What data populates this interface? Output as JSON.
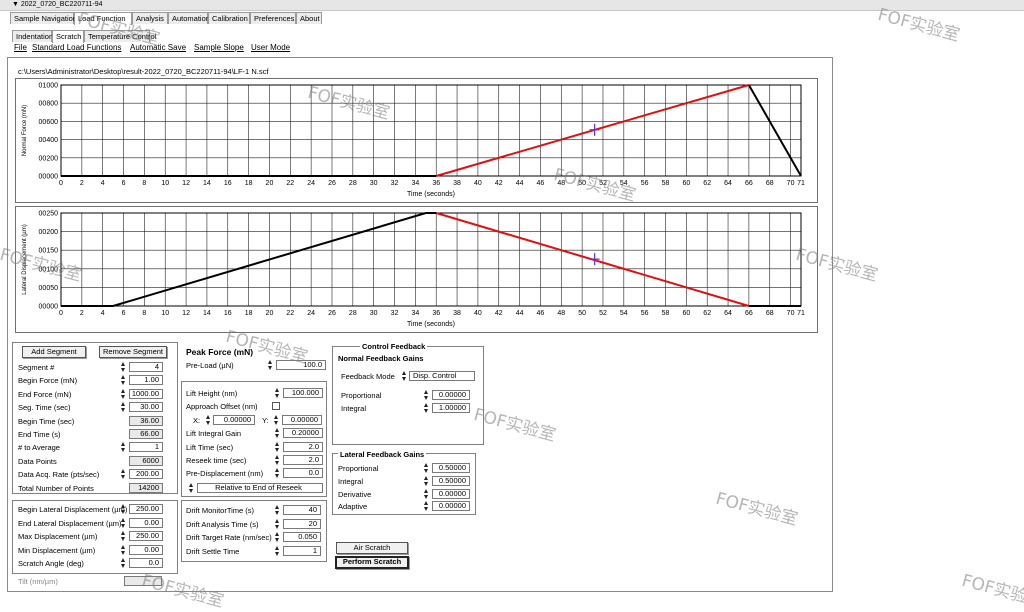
{
  "window": {
    "title": "▼ 2022_0720_BC220711-94"
  },
  "main_tabs": [
    "Sample Navigation",
    "Load Function",
    "Analysis",
    "Automation",
    "Calibration",
    "Preferences",
    "About"
  ],
  "sub_tabs": [
    "Indentation",
    "Scratch",
    "Temperature Control"
  ],
  "menu": [
    "File",
    "Standard Load Functions",
    "Automatic Save",
    "Sample Slope",
    "User Mode"
  ],
  "file_path": "c:\\Users\\Administrator\\Desktop\\result-2022_0720_BC220711-94\\LF-1 N.scf",
  "chart_data": [
    {
      "type": "line",
      "ylabel": "Normal Force (mN)",
      "xlabel": "Time (seconds)",
      "ylim": [
        0,
        1000
      ],
      "xlim": [
        0,
        71
      ],
      "yticks": [
        "00000",
        "00200",
        "00400",
        "00600",
        "00800",
        "01000"
      ],
      "xticks": [
        "0",
        "2",
        "4",
        "6",
        "8",
        "10",
        "12",
        "14",
        "16",
        "18",
        "20",
        "22",
        "24",
        "26",
        "28",
        "30",
        "32",
        "34",
        "36",
        "38",
        "40",
        "42",
        "44",
        "46",
        "48",
        "50",
        "52",
        "54",
        "56",
        "58",
        "60",
        "62",
        "64",
        "66",
        "68",
        "70",
        "71"
      ],
      "grid": true,
      "series": [
        {
          "color": "#000000",
          "x": [
            0,
            36
          ],
          "y": [
            0,
            0
          ]
        },
        {
          "color": "#e01010",
          "x": [
            36,
            66
          ],
          "y": [
            0,
            1000
          ]
        },
        {
          "color": "#000000",
          "x": [
            66,
            71
          ],
          "y": [
            1000,
            0
          ]
        }
      ],
      "marker": {
        "x": 51.2,
        "y": 508
      }
    },
    {
      "type": "line",
      "ylabel": "Lateral Displacement (µm)",
      "xlabel": "Time (seconds)",
      "ylim": [
        0,
        250
      ],
      "xlim": [
        0,
        71
      ],
      "yticks": [
        "00000",
        "00050",
        "00100",
        "00150",
        "00200",
        "00250"
      ],
      "xticks": [
        "0",
        "2",
        "4",
        "6",
        "8",
        "10",
        "12",
        "14",
        "16",
        "18",
        "20",
        "22",
        "24",
        "26",
        "28",
        "30",
        "32",
        "34",
        "36",
        "38",
        "40",
        "42",
        "44",
        "46",
        "48",
        "50",
        "52",
        "54",
        "56",
        "58",
        "60",
        "62",
        "64",
        "66",
        "68",
        "70",
        "71"
      ],
      "grid": true,
      "series": [
        {
          "color": "#000000",
          "x": [
            0,
            5,
            35,
            36
          ],
          "y": [
            0,
            0,
            250,
            250
          ]
        },
        {
          "color": "#e01010",
          "x": [
            36,
            66
          ],
          "y": [
            250,
            0
          ]
        },
        {
          "color": "#000000",
          "x": [
            66,
            71
          ],
          "y": [
            0,
            0
          ]
        }
      ],
      "marker": {
        "x": 51.2,
        "y": 126
      }
    }
  ],
  "segments": {
    "add_label": "Add Segment",
    "remove_label": "Remove Segment",
    "rows": [
      {
        "label": "Segment #",
        "value": "4"
      },
      {
        "label": "Begin Force (mN)",
        "value": "1.00"
      },
      {
        "label": "End Force (mN)",
        "value": "1000.00"
      },
      {
        "label": "Seg. Time (sec)",
        "value": "30.00"
      },
      {
        "label": "Begin Time (sec)",
        "value": "36.00"
      },
      {
        "label": "End Time (s)",
        "value": "66.00"
      },
      {
        "label": "# to Average",
        "value": "1"
      },
      {
        "label": "Data Points",
        "value": "6000"
      },
      {
        "label": "Data Acq. Rate (pts/sec)",
        "value": "200.00"
      },
      {
        "label": "Total Number of Points",
        "value": "14200"
      }
    ]
  },
  "displacement": {
    "rows": [
      {
        "label": "Begin Lateral Displacement (µm)",
        "value": "250.00"
      },
      {
        "label": "End Lateral Displacement (µm)",
        "value": "0.00"
      },
      {
        "label": "Max Displacement (µm)",
        "value": "250.00"
      },
      {
        "label": "Min Displacement (µm)",
        "value": "0.00"
      },
      {
        "label": "Scratch Angle (deg)",
        "value": "0.0"
      }
    ],
    "tilt_label": "Tilt (nm/µm)"
  },
  "peak": {
    "title": "Peak Force (mN)",
    "preload_label": "Pre-Load (µN)",
    "preload_value": "100.0"
  },
  "lift": {
    "rows": [
      {
        "label": "Lift Height (nm)",
        "value": "100.000"
      },
      {
        "label": "Lift Integral Gain",
        "value": "0.20000"
      },
      {
        "label": "Lift Time (sec)",
        "value": "2.0"
      },
      {
        "label": "Reseek time (sec)",
        "value": "2.0"
      },
      {
        "label": "Pre-Displacement (nm)",
        "value": "0.0"
      }
    ],
    "approach_label": "Approach Offset (nm)",
    "x_label": "X:",
    "x_value": "0.00000",
    "y_label": "Y:",
    "y_value": "0.00000",
    "relative_label": "Relative to End of Reseek"
  },
  "drift": {
    "rows": [
      {
        "label": "Drift MonitorTime (s)",
        "value": "40"
      },
      {
        "label": "Drift Analysis Time (s)",
        "value": "20"
      },
      {
        "label": "Drift Target Rate (nm/sec)",
        "value": "0.050"
      },
      {
        "label": "Drift Settle Time",
        "value": "1"
      }
    ]
  },
  "control": {
    "title": "Control Feedback",
    "normal_title": "Normal Feedback Gains",
    "feedback_mode_label": "Feedback Mode",
    "feedback_mode_value": "Disp. Control",
    "rows": [
      {
        "label": "Proportional",
        "value": "0.00000"
      },
      {
        "label": "Integral",
        "value": "1.00000"
      }
    ]
  },
  "lateral": {
    "title": "Lateral Feedback Gains",
    "rows": [
      {
        "label": "Proportional",
        "value": "0.50000"
      },
      {
        "label": "Integral",
        "value": "0.50000"
      },
      {
        "label": "Derivative",
        "value": "0.00000"
      },
      {
        "label": "Adaptive",
        "value": "0.00000"
      }
    ]
  },
  "actions": {
    "air_label": "Air Scratch",
    "perform_label": "Perform Scratch"
  },
  "watermark": "FOF实验室"
}
